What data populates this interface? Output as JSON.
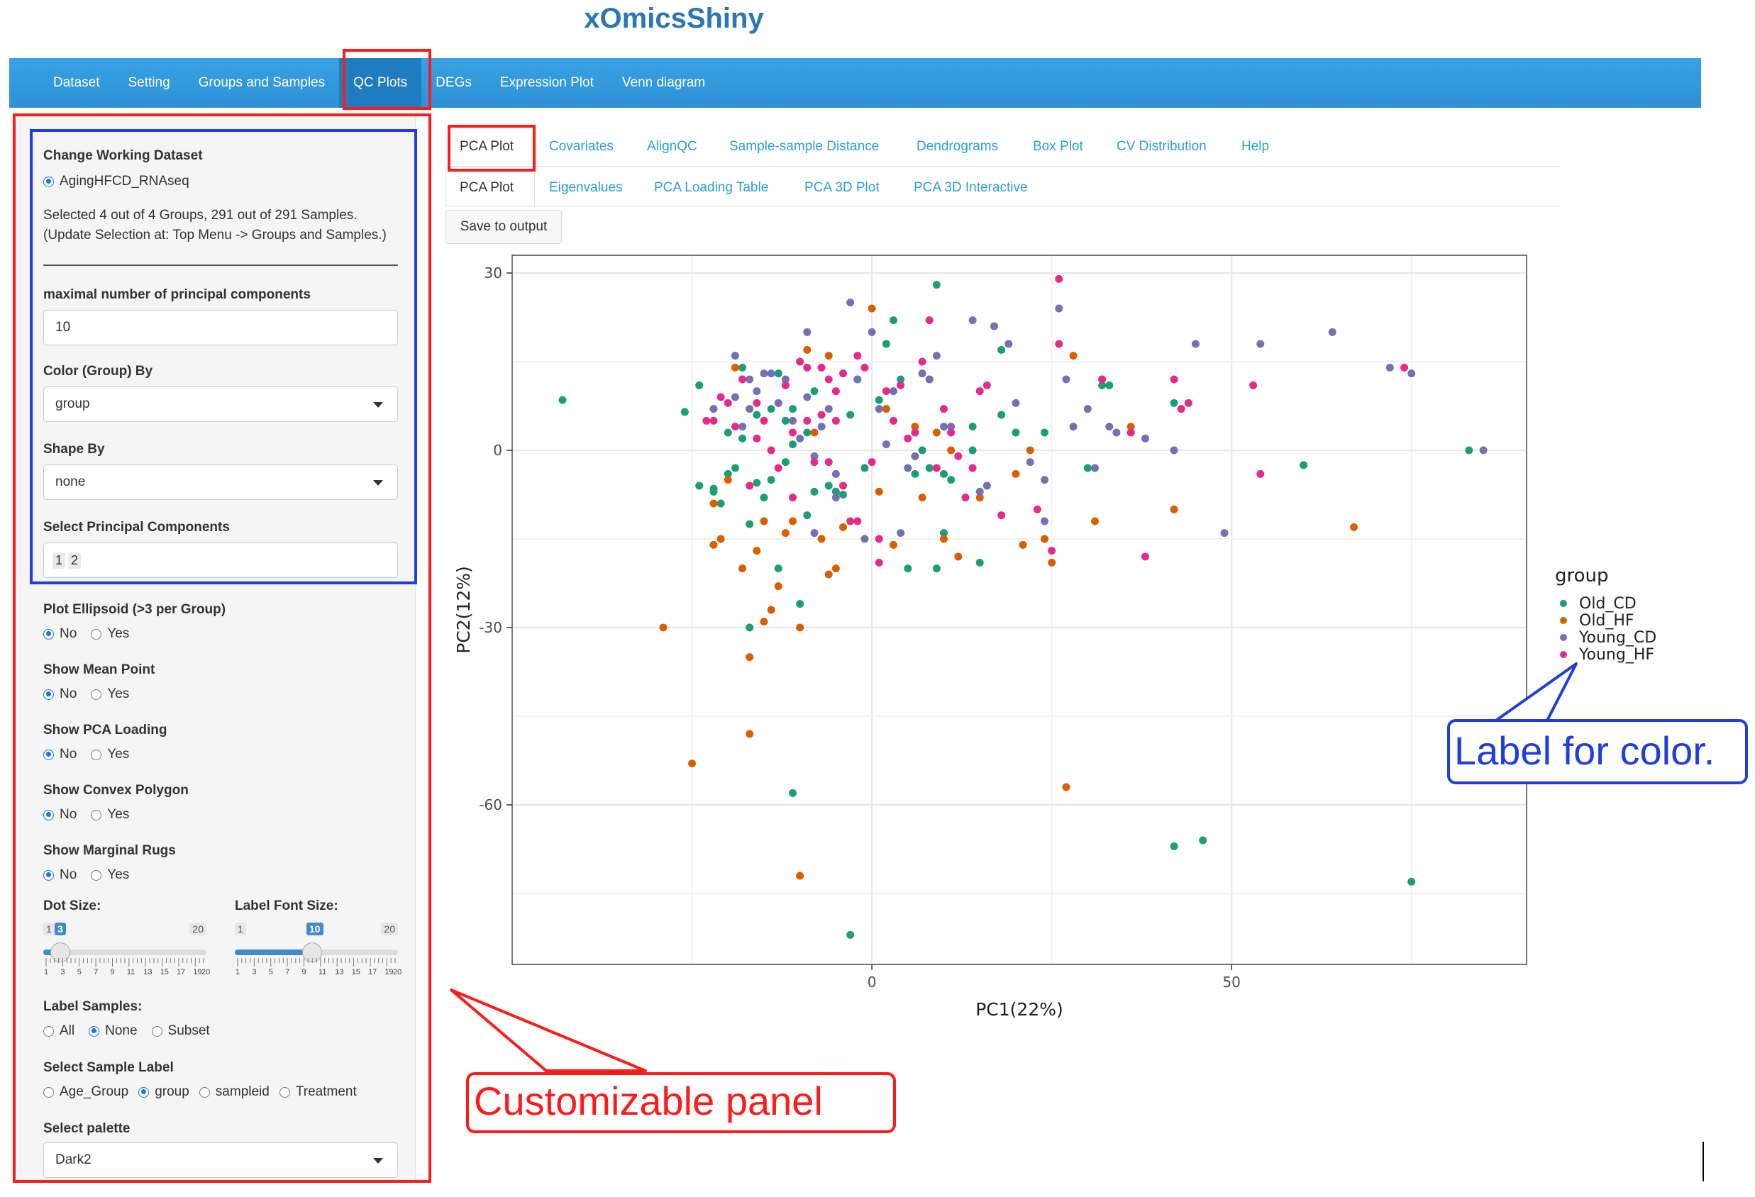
{
  "app": {
    "title": "xOmicsShiny"
  },
  "navbar": {
    "items": [
      "Dataset",
      "Setting",
      "Groups and Samples",
      "QC Plots",
      "DEGs",
      "Expression Plot",
      "Venn diagram"
    ],
    "active": "QC Plots"
  },
  "sidebar": {
    "dataset_label": "Change Working Dataset",
    "dataset_option": "AgingHFCD_RNAseq",
    "selection_line1": "Selected 4 out of 4 Groups, 291 out of 291 Samples.",
    "selection_line2": "(Update Selection at: Top Menu -> Groups and Samples.)",
    "max_pc_label": "maximal number of principal components",
    "max_pc_value": "10",
    "color_by_label": "Color (Group) By",
    "color_by_value": "group",
    "shape_by_label": "Shape By",
    "shape_by_value": "none",
    "select_pc_label": "Select Principal Components",
    "select_pc_values": [
      "1",
      "2"
    ],
    "radio_groups": [
      {
        "label": "Plot Ellipsoid (>3 per Group)",
        "options": [
          "No",
          "Yes"
        ],
        "selected": "No"
      },
      {
        "label": "Show Mean Point",
        "options": [
          "No",
          "Yes"
        ],
        "selected": "No"
      },
      {
        "label": "Show PCA Loading",
        "options": [
          "No",
          "Yes"
        ],
        "selected": "No"
      },
      {
        "label": "Show Convex Polygon",
        "options": [
          "No",
          "Yes"
        ],
        "selected": "No"
      },
      {
        "label": "Show Marginal Rugs",
        "options": [
          "No",
          "Yes"
        ],
        "selected": "No"
      }
    ],
    "dot_size": {
      "label": "Dot Size:",
      "min": "1",
      "max": "20",
      "value": "3",
      "fraction": 0.105
    },
    "label_font": {
      "label": "Label Font Size:",
      "min": "1",
      "max": "20",
      "value": "10",
      "fraction": 0.474
    },
    "slider_ticks": [
      "1",
      "3",
      "5",
      "7",
      "9",
      "11",
      "13",
      "15",
      "17",
      "19",
      "20"
    ],
    "label_samples": {
      "label": "Label Samples:",
      "options": [
        "All",
        "None",
        "Subset"
      ],
      "selected": "None"
    },
    "sample_label": {
      "label": "Select Sample Label",
      "options": [
        "Age_Group",
        "group",
        "sampleid",
        "Treatment"
      ],
      "selected": "group"
    },
    "palette": {
      "label": "Select palette",
      "value": "Dark2"
    }
  },
  "tabs_row1": {
    "items": [
      "PCA Plot",
      "Covariates",
      "AlignQC",
      "Sample-sample Distance",
      "Dendrograms",
      "Box Plot",
      "CV Distribution",
      "Help"
    ],
    "active": "PCA Plot"
  },
  "tabs_row2": {
    "items": [
      "PCA Plot",
      "Eigenvalues",
      "PCA Loading Table",
      "PCA 3D Plot",
      "PCA 3D Interactive"
    ],
    "active": "PCA Plot"
  },
  "save_button": "Save to output",
  "annotations": {
    "panel": "Customizable panel",
    "legend": "Label for color."
  },
  "colors": {
    "Old_CD": "#1b9e77",
    "Old_HF": "#d95f02",
    "Young_CD": "#7570b3",
    "Young_HF": "#e7298a",
    "annotation_red": "#ff1a1a",
    "annotation_blue": "#1f3de0"
  },
  "chart_data": {
    "type": "scatter",
    "xlabel": "PC1(22%)",
    "ylabel": "PC2(12%)",
    "xlim": [
      -50,
      91
    ],
    "ylim": [
      -87,
      33
    ],
    "xticks": [
      0,
      50
    ],
    "yticks": [
      30,
      0,
      -30,
      -60
    ],
    "grid": true,
    "legend": {
      "title": "group",
      "placement": "right"
    },
    "series": [
      {
        "name": "Old_CD",
        "points": [
          [
            -43,
            8.5
          ],
          [
            -26,
            6.5
          ],
          [
            -24,
            11
          ],
          [
            -24,
            -6
          ],
          [
            -22,
            -6.5
          ],
          [
            -22,
            -7
          ],
          [
            -21,
            -9
          ],
          [
            -20,
            -4
          ],
          [
            -20,
            3
          ],
          [
            -19,
            -3
          ],
          [
            -18,
            2
          ],
          [
            -18,
            14
          ],
          [
            -17,
            -12.5
          ],
          [
            -17,
            -30
          ],
          [
            -16,
            -5.5
          ],
          [
            -16,
            6
          ],
          [
            -15,
            -8
          ],
          [
            -14,
            7
          ],
          [
            -14,
            -5
          ],
          [
            -13,
            13
          ],
          [
            -13,
            -20
          ],
          [
            -12,
            -2
          ],
          [
            -12,
            5
          ],
          [
            -11,
            1
          ],
          [
            -11,
            7
          ],
          [
            -11,
            -58
          ],
          [
            -10,
            -26
          ],
          [
            -9,
            3
          ],
          [
            -9,
            -11
          ],
          [
            -8,
            10
          ],
          [
            -8,
            -7
          ],
          [
            -6,
            -6
          ],
          [
            -5,
            -7
          ],
          [
            -4,
            -7.5
          ],
          [
            -3,
            -82
          ],
          [
            -3,
            6
          ],
          [
            -2,
            12
          ],
          [
            -1,
            -3
          ],
          [
            1,
            8.5
          ],
          [
            2,
            18
          ],
          [
            3,
            22
          ],
          [
            4,
            12
          ],
          [
            5,
            -20
          ],
          [
            6,
            -4
          ],
          [
            7,
            0
          ],
          [
            8,
            -3
          ],
          [
            9,
            28
          ],
          [
            9,
            -20
          ],
          [
            10,
            -4
          ],
          [
            10,
            -14
          ],
          [
            11,
            -5
          ],
          [
            14,
            0
          ],
          [
            14,
            4
          ],
          [
            15,
            -19
          ],
          [
            18,
            17
          ],
          [
            18,
            6
          ],
          [
            20,
            3
          ],
          [
            24,
            3
          ],
          [
            30,
            -3
          ],
          [
            32,
            11
          ],
          [
            33,
            11
          ],
          [
            42,
            -67
          ],
          [
            42,
            8
          ],
          [
            46,
            -66
          ],
          [
            60,
            -2.5
          ],
          [
            75,
            -73
          ],
          [
            83,
            0
          ]
        ]
      },
      {
        "name": "Old_HF",
        "points": [
          [
            -29,
            -30
          ],
          [
            -25,
            -53
          ],
          [
            -22,
            -9
          ],
          [
            -22,
            -16
          ],
          [
            -21,
            -15
          ],
          [
            -20,
            -5
          ],
          [
            -19,
            14
          ],
          [
            -18,
            -20
          ],
          [
            -17,
            -35
          ],
          [
            -17,
            -48
          ],
          [
            -16,
            -17
          ],
          [
            -15,
            -12
          ],
          [
            -15,
            -29
          ],
          [
            -14,
            -27
          ],
          [
            -13,
            -23
          ],
          [
            -12,
            -14
          ],
          [
            -11,
            -12
          ],
          [
            -10,
            -30
          ],
          [
            -10,
            -72
          ],
          [
            -9,
            17
          ],
          [
            -8,
            3
          ],
          [
            -7,
            -15
          ],
          [
            -6,
            -21
          ],
          [
            -6,
            16
          ],
          [
            -5,
            -20
          ],
          [
            -4,
            -13
          ],
          [
            0,
            24
          ],
          [
            1,
            -7
          ],
          [
            2,
            7
          ],
          [
            3,
            -16
          ],
          [
            6,
            4
          ],
          [
            7,
            -8
          ],
          [
            8,
            12
          ],
          [
            9,
            3
          ],
          [
            10,
            -15
          ],
          [
            11,
            0
          ],
          [
            12,
            -18
          ],
          [
            15,
            -8
          ],
          [
            20,
            -4
          ],
          [
            21,
            -16
          ],
          [
            22,
            0
          ],
          [
            24,
            -15
          ],
          [
            25,
            -19
          ],
          [
            27,
            -57
          ],
          [
            28,
            16
          ],
          [
            31,
            -12
          ],
          [
            36,
            4
          ],
          [
            42,
            -10
          ],
          [
            67,
            -13
          ]
        ]
      },
      {
        "name": "Young_CD",
        "points": [
          [
            -22,
            7
          ],
          [
            -19,
            16
          ],
          [
            -19,
            9
          ],
          [
            -18,
            4
          ],
          [
            -17,
            12
          ],
          [
            -17,
            7
          ],
          [
            -16,
            10
          ],
          [
            -15,
            13
          ],
          [
            -14,
            13
          ],
          [
            -13,
            8
          ],
          [
            -12,
            12
          ],
          [
            -11,
            5
          ],
          [
            -10,
            2
          ],
          [
            -9,
            20
          ],
          [
            -9,
            9
          ],
          [
            -8,
            -1
          ],
          [
            -8,
            -14
          ],
          [
            -7,
            4
          ],
          [
            -6,
            7
          ],
          [
            -5,
            -4
          ],
          [
            -5,
            -8
          ],
          [
            -3,
            25
          ],
          [
            -2,
            12
          ],
          [
            -1,
            -15
          ],
          [
            0,
            20
          ],
          [
            1,
            7
          ],
          [
            2,
            1
          ],
          [
            3,
            10
          ],
          [
            4,
            -14
          ],
          [
            5,
            -3
          ],
          [
            6,
            -1
          ],
          [
            7,
            13
          ],
          [
            8,
            12
          ],
          [
            9,
            16
          ],
          [
            10,
            4
          ],
          [
            11,
            4
          ],
          [
            14,
            22
          ],
          [
            15,
            -7
          ],
          [
            16,
            -6
          ],
          [
            17,
            21
          ],
          [
            19,
            18
          ],
          [
            20,
            8
          ],
          [
            22,
            -2
          ],
          [
            24,
            -5
          ],
          [
            24,
            -12
          ],
          [
            26,
            24
          ],
          [
            27,
            12
          ],
          [
            28,
            4
          ],
          [
            30,
            7
          ],
          [
            31,
            -3
          ],
          [
            32,
            12
          ],
          [
            33,
            4
          ],
          [
            34,
            3
          ],
          [
            38,
            2
          ],
          [
            42,
            0
          ],
          [
            45,
            18
          ],
          [
            49,
            -14
          ],
          [
            54,
            18
          ],
          [
            64,
            20
          ],
          [
            72,
            14
          ],
          [
            75,
            13
          ],
          [
            85,
            0
          ]
        ]
      },
      {
        "name": "Young_HF",
        "points": [
          [
            -23,
            5
          ],
          [
            -22,
            5
          ],
          [
            -21,
            9
          ],
          [
            -20,
            8
          ],
          [
            -19,
            4
          ],
          [
            -18,
            12
          ],
          [
            -17,
            -6
          ],
          [
            -16,
            8
          ],
          [
            -16,
            2
          ],
          [
            -15,
            5
          ],
          [
            -14,
            0
          ],
          [
            -13,
            -3
          ],
          [
            -12,
            11
          ],
          [
            -11,
            3
          ],
          [
            -11,
            -8
          ],
          [
            -10,
            15
          ],
          [
            -9,
            14
          ],
          [
            -9,
            5
          ],
          [
            -8,
            -2
          ],
          [
            -7,
            14
          ],
          [
            -7,
            6
          ],
          [
            -6,
            12
          ],
          [
            -6,
            -2
          ],
          [
            -5,
            10
          ],
          [
            -5,
            5
          ],
          [
            -4,
            13
          ],
          [
            -4,
            -6
          ],
          [
            -3,
            -12
          ],
          [
            -2,
            16
          ],
          [
            -2,
            -12
          ],
          [
            -1,
            14
          ],
          [
            0,
            -2
          ],
          [
            1,
            -15
          ],
          [
            1,
            -19
          ],
          [
            2,
            10
          ],
          [
            3,
            5
          ],
          [
            4,
            11
          ],
          [
            5,
            2
          ],
          [
            6,
            3
          ],
          [
            7,
            15
          ],
          [
            8,
            22
          ],
          [
            9,
            -3
          ],
          [
            10,
            7
          ],
          [
            11,
            3
          ],
          [
            12,
            -1
          ],
          [
            13,
            -8
          ],
          [
            14,
            -3
          ],
          [
            15,
            10
          ],
          [
            16,
            11
          ],
          [
            18,
            -11
          ],
          [
            23,
            -10
          ],
          [
            25,
            -17
          ],
          [
            26,
            18
          ],
          [
            26,
            29
          ],
          [
            32,
            12
          ],
          [
            36,
            3
          ],
          [
            38,
            -18
          ],
          [
            42,
            12
          ],
          [
            43,
            7
          ],
          [
            44,
            8
          ],
          [
            53,
            11
          ],
          [
            54,
            -4
          ],
          [
            74,
            14
          ]
        ]
      }
    ]
  }
}
